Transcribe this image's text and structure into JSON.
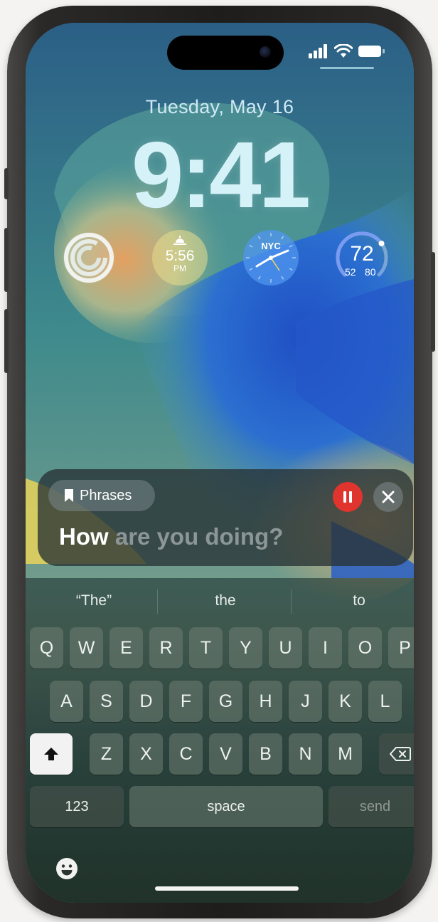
{
  "status_bar": {
    "signal_icon": "cellular-signal-icon",
    "wifi_icon": "wifi-icon",
    "battery_icon": "battery-icon"
  },
  "lock_screen": {
    "date": "Tuesday, May 16",
    "time": "9:41"
  },
  "widgets": {
    "activity": {
      "icon": "activity-rings-icon"
    },
    "sunset": {
      "time": "5:56",
      "period": "PM",
      "icon": "sunset-icon"
    },
    "world_clock": {
      "city": "NYC"
    },
    "weather": {
      "temperature": "72",
      "low": "52",
      "high": "80",
      "level": 0.7
    }
  },
  "live_speech": {
    "phrases_label": "Phrases",
    "spoken_word": "How",
    "remaining_text": "are you doing?",
    "pause_icon": "pause-icon",
    "close_icon": "close-icon"
  },
  "keyboard": {
    "suggestions": [
      "“The”",
      "the",
      "to"
    ],
    "row1": [
      "Q",
      "W",
      "E",
      "R",
      "T",
      "Y",
      "U",
      "I",
      "O",
      "P"
    ],
    "row2": [
      "A",
      "S",
      "D",
      "F",
      "G",
      "H",
      "J",
      "K",
      "L"
    ],
    "row3": [
      "Z",
      "X",
      "C",
      "V",
      "B",
      "N",
      "M"
    ],
    "numbers_key": "123",
    "space_key": "space",
    "send_key": "send",
    "shift_icon": "shift-icon",
    "delete_icon": "delete-icon",
    "emoji_icon": "emoji-icon"
  },
  "colors": {
    "pause_button": "#e0342e",
    "time_text": "#d5f2f8",
    "card_background": "#283234"
  }
}
